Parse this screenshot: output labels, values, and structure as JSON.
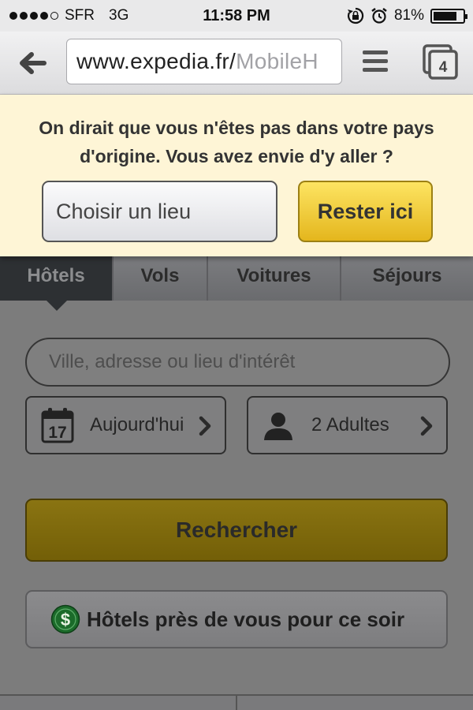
{
  "status_bar": {
    "carrier": "SFR",
    "network": "3G",
    "time": "11:58 PM",
    "battery_text": "81%",
    "battery_level": 0.81,
    "signal_bars_filled": 4,
    "signal_bars_total": 5,
    "icons": [
      "orientation-lock-icon",
      "alarm-icon"
    ]
  },
  "browser": {
    "url_main": "www.expedia.fr/",
    "url_rest": "MobileH",
    "tab_count": "4",
    "icons": [
      "back-arrow-icon",
      "menu-icon",
      "tabs-icon"
    ]
  },
  "banner": {
    "message": "On dirait que vous n'êtes pas dans votre pays d'origine. Vous avez envie d'y aller ?",
    "choose_label": "Choisir un lieu",
    "stay_label": "Rester ici",
    "stay_color": "#f2c838"
  },
  "tabs": [
    {
      "label": "Hôtels",
      "active": true
    },
    {
      "label": "Vols",
      "active": false
    },
    {
      "label": "Voitures",
      "active": false
    },
    {
      "label": "Séjours",
      "active": false
    }
  ],
  "search": {
    "placeholder": "Ville, adresse ou lieu d'intérêt",
    "date_day": "17",
    "date_label": "Aujourd'hui",
    "guests_label": "2 Adultes",
    "search_label": "Rechercher",
    "tonight_label": "Hôtels près de vous pour ce soir",
    "dollar_symbol": "$"
  },
  "colors": {
    "overlay": "#7c7c7c",
    "banner_bg": "#fef5d6",
    "active_tab": "#2d3033",
    "search_button": "#7f6a0c"
  }
}
